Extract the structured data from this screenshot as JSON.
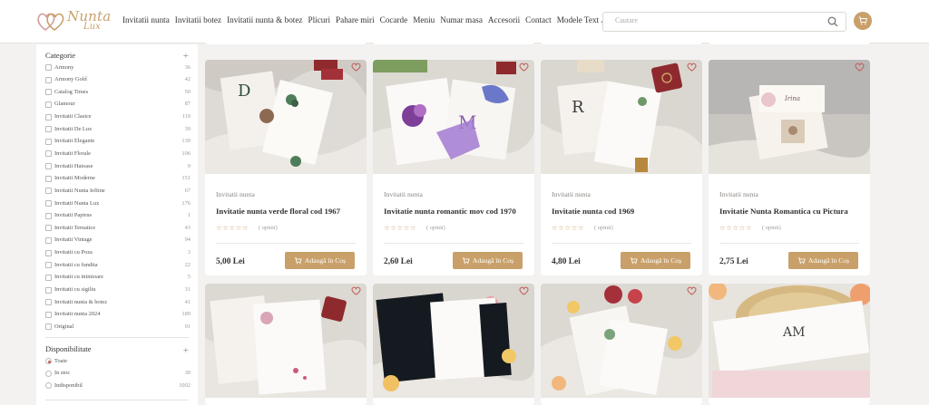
{
  "header": {
    "brand_line1": "Nunta",
    "brand_line2": "Lux",
    "nav": [
      {
        "label": "Invitatii nunta"
      },
      {
        "label": "Invitatii botez"
      },
      {
        "label": "Invitatii nunta & botez"
      },
      {
        "label": "Plicuri"
      },
      {
        "label": "Pahare miri"
      },
      {
        "label": "Cocarde"
      },
      {
        "label": "Meniu"
      },
      {
        "label": "Numar masa"
      },
      {
        "label": "Accesorii"
      },
      {
        "label": "Contact"
      },
      {
        "label": "Modele Text"
      }
    ],
    "search_placeholder": "Cautare"
  },
  "sidebar": {
    "categories_title": "Categorie",
    "categories": [
      {
        "label": "Armony",
        "count": "36"
      },
      {
        "label": "Armony Gold",
        "count": "42"
      },
      {
        "label": "Catalog Times",
        "count": "50"
      },
      {
        "label": "Glamour",
        "count": "87"
      },
      {
        "label": "Invitatii Clasice",
        "count": "119"
      },
      {
        "label": "Invitatii De Lux",
        "count": "39"
      },
      {
        "label": "Invitatii Elegante",
        "count": "139"
      },
      {
        "label": "Invitatii Florale",
        "count": "106"
      },
      {
        "label": "Invitatii Haioase",
        "count": "9"
      },
      {
        "label": "Invitatii Moderne",
        "count": "151"
      },
      {
        "label": "Invitatii Nunta Ieftine",
        "count": "67"
      },
      {
        "label": "Invitatii Nunta Lux",
        "count": "176"
      },
      {
        "label": "Invitatii Papirus",
        "count": "1"
      },
      {
        "label": "Invitatii Tematice",
        "count": "43"
      },
      {
        "label": "Invitatii Vintage",
        "count": "94"
      },
      {
        "label": "Invitatii cu Poza",
        "count": "3"
      },
      {
        "label": "Invitatii cu fundita",
        "count": "22"
      },
      {
        "label": "Invitatii cu inimioare",
        "count": "5"
      },
      {
        "label": "Invitatii cu sigiliu",
        "count": "31"
      },
      {
        "label": "Invitatii nunta & botez",
        "count": "41"
      },
      {
        "label": "Invitatii nunta 2024",
        "count": "189"
      },
      {
        "label": "Original",
        "count": "91"
      }
    ],
    "availability_title": "Disponibilitate",
    "availability": [
      {
        "label": "Toate",
        "count": ""
      },
      {
        "label": "In stoc",
        "count": "30"
      },
      {
        "label": "Indisponibil",
        "count": "1002"
      }
    ]
  },
  "products_row1": [
    {
      "category": "Invitatii nunta",
      "title": "Invitatie nunta verde floral cod 1967",
      "stars": "☆☆☆☆☆",
      "opinions": "( opinii)",
      "price": "5,00 Lei",
      "button": "Adaugă în Coș"
    },
    {
      "category": "Invitatii nunta",
      "title": "Invitatie nunta romantic mov cod 1970",
      "stars": "☆☆☆☆☆",
      "opinions": "( opinii)",
      "price": "2,60 Lei",
      "button": "Adaugă în Coș"
    },
    {
      "category": "Invitatii nunta",
      "title": "Invitatie nunta cod 1969",
      "stars": "☆☆☆☆☆",
      "opinions": "( opinii)",
      "price": "4,80 Lei",
      "button": "Adaugă în Coș"
    },
    {
      "category": "Invitatii nunta",
      "title": "Invitatie Nunta Romantica cu Pictura",
      "stars": "☆☆☆☆☆",
      "opinions": "( opinii)",
      "price": "2,75 Lei",
      "button": "Adaugă în Coș"
    }
  ],
  "colors": {
    "accent": "#c9a06a",
    "heart": "#c25b5b",
    "background": "#f3f2f1"
  }
}
